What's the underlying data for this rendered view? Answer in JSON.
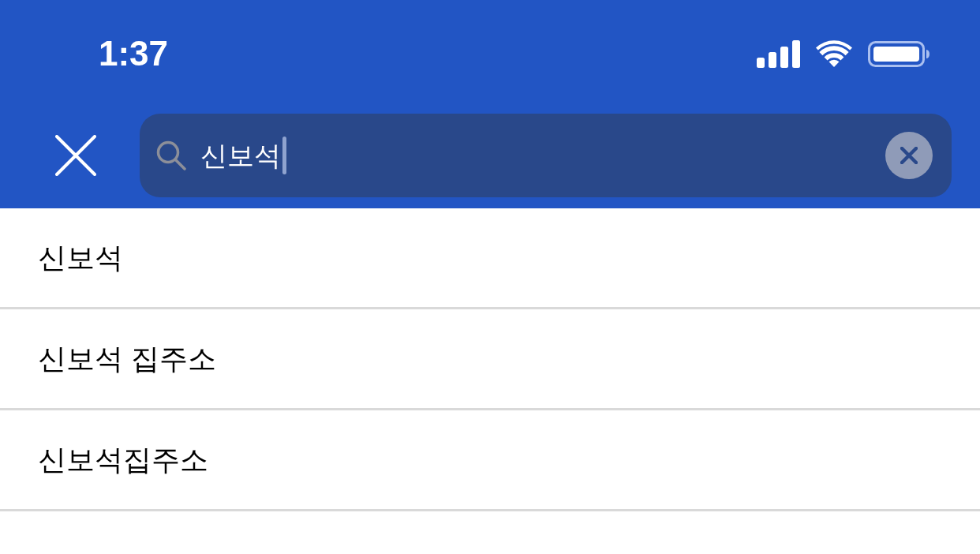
{
  "status_bar": {
    "time": "1:37"
  },
  "search": {
    "value": "신보석",
    "focused": true
  },
  "suggestions": [
    {
      "text": "신보석"
    },
    {
      "text": "신보석 집주소"
    },
    {
      "text": "신보석집주소"
    }
  ]
}
